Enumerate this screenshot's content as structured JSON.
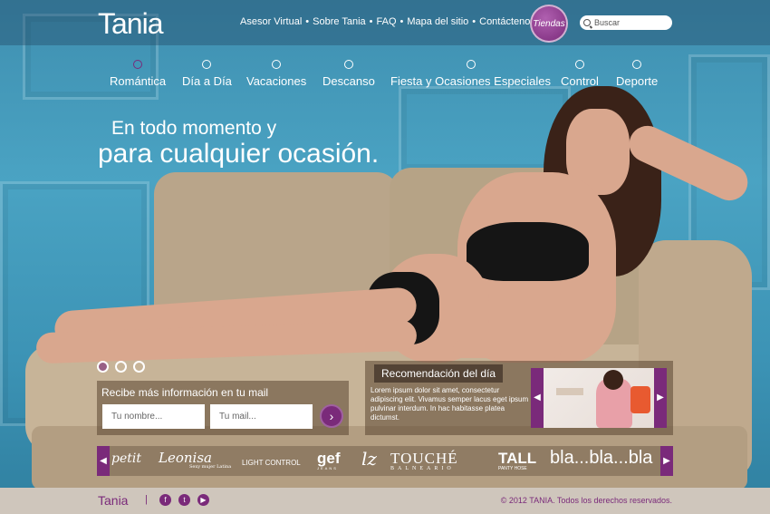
{
  "header": {
    "logo": "Tania",
    "top_links": [
      "Asesor Virtual",
      "Sobre Tania",
      "FAQ",
      "Mapa del sitio",
      "Contáctenos"
    ],
    "separator": "•",
    "tiendas_badge": "Tiendas",
    "search_placeholder": "Buscar"
  },
  "main_nav": [
    "Romántica",
    "Día a Día",
    "Vacaciones",
    "Descanso",
    "Fiesta y Ocasiones Especiales",
    "Control",
    "Deporte"
  ],
  "hero": {
    "tagline_line1": "En todo momento y",
    "tagline_line2": "para cualquier ocasión."
  },
  "newsletter": {
    "title": "Recibe más información en tu mail",
    "name_placeholder": "Tu nombre...",
    "mail_placeholder": "Tu mail...",
    "submit_icon": "›"
  },
  "recommendation": {
    "title": "Recomendación del día",
    "body": "Lorem ipsum dolor sit amet, consectetur adipiscing elit. Vivamus semper lacus eget ipsum pulvinar interdum. In hac habitasse platea dictumst."
  },
  "brands": [
    "petit",
    "Leonisa",
    "LIGHT CONTROL",
    "gef",
    "lz",
    "TOUCHÉ",
    "TALL",
    "bla...bla...bla"
  ],
  "brand_subtitles": {
    "leonisa": "Sexy mujer Latina",
    "touche": "BALNEARIO",
    "tall": "PANTY HOSE",
    "gef": "JEANS"
  },
  "footer": {
    "logo": "Tania",
    "separator": "|",
    "social": [
      "f",
      "t",
      "▶"
    ],
    "copyright": "© 2012 TANIA. Todos los derechos reservados."
  },
  "colors": {
    "accent": "#7a2a7a",
    "header_text": "#ffffff"
  }
}
